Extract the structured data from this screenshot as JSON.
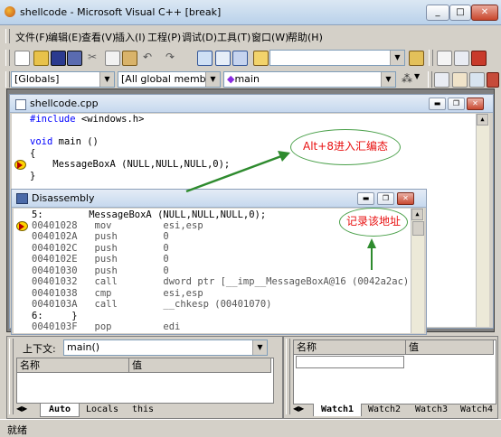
{
  "window": {
    "title": "shellcode - Microsoft Visual C++ [break]"
  },
  "menu": [
    "文件(F)",
    "编辑(E)",
    "查看(V)",
    "插入(I)",
    "工程(P)",
    "调试(D)",
    "工具(T)",
    "窗口(W)",
    "帮助(H)"
  ],
  "wizardbar": {
    "scope": "[Globals]",
    "members": "[All global members",
    "function": "main"
  },
  "editor": {
    "title": "shellcode.cpp",
    "lines": [
      "#include <windows.h>",
      "",
      "void main ()",
      "{",
      "    MessageBoxA (NULL,NULL,NULL,0);",
      "}"
    ]
  },
  "disassembly": {
    "title": "Disassembly",
    "lines": [
      "5:        MessageBoxA (NULL,NULL,NULL,0);",
      "00401028   mov         esi,esp",
      "0040102A   push        0",
      "0040102C   push        0",
      "0040102E   push        0",
      "00401030   push        0",
      "00401032   call        dword ptr [__imp__MessageBoxA@16 (0042a2ac)]",
      "00401038   cmp         esi,esp",
      "0040103A   call        __chkesp (00401070)",
      "6:     }",
      "0040103F   pop         edi"
    ]
  },
  "annotations": {
    "hotkey": "Alt+8进入汇编态",
    "record": "记录该地址"
  },
  "variables": {
    "context_label": "上下文:",
    "context_value": "main()",
    "col_name": "名称",
    "col_value": "值",
    "tabs": [
      "Auto",
      "Locals",
      "this"
    ]
  },
  "watch": {
    "col_name": "名称",
    "col_value": "值",
    "tabs": [
      "Watch1",
      "Watch2",
      "Watch3",
      "Watch4"
    ]
  },
  "status": {
    "text": "就绪"
  },
  "colors": {
    "keyword": "#0000ff",
    "annotation_text": "#e81010",
    "annotation_arrow": "#2e8b2e"
  }
}
